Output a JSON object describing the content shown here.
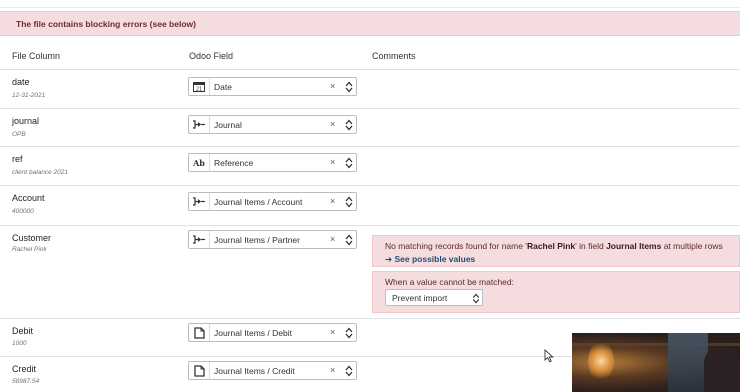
{
  "banner": {
    "text": "The file contains blocking errors (see below)"
  },
  "columns": {
    "file_column": "File Column",
    "odoo_field": "Odoo Field",
    "comments": "Comments"
  },
  "rows": [
    {
      "name": "date",
      "sample": "12-31-2021",
      "field": "Date",
      "icon": "calendar-icon"
    },
    {
      "name": "journal",
      "sample": "OPB",
      "field": "Journal",
      "icon": "relation-icon"
    },
    {
      "name": "ref",
      "sample": "client balance 2021",
      "field": "Reference",
      "icon": "text-ab-icon"
    },
    {
      "name": "Account",
      "sample": "400000",
      "field": "Journal Items / Account",
      "icon": "relation-icon"
    },
    {
      "name": "Customer",
      "sample": "Rachel Pink",
      "field": "Journal Items / Partner",
      "icon": "relation-icon"
    },
    {
      "name": "Debit",
      "sample": "1000",
      "field": "Journal Items / Debit",
      "icon": "document-icon"
    },
    {
      "name": "Credit",
      "sample": "58987.54",
      "field": "Journal Items / Credit",
      "icon": "document-icon"
    }
  ],
  "customer_warning": {
    "prefix": "No matching records found for name '",
    "name": "Rachel Pink",
    "middle": "' in field ",
    "field": "Journal Items",
    "suffix": " at multiple rows",
    "link": "➔ See possible values",
    "unmatched_label": "When a value cannot be matched:",
    "unmatched_value": "Prevent import"
  },
  "clear_symbol": "×",
  "colors": {
    "banner_bg": "#f5dcdf",
    "banner_text": "#6f2a2f",
    "link": "#1f4e6e"
  }
}
